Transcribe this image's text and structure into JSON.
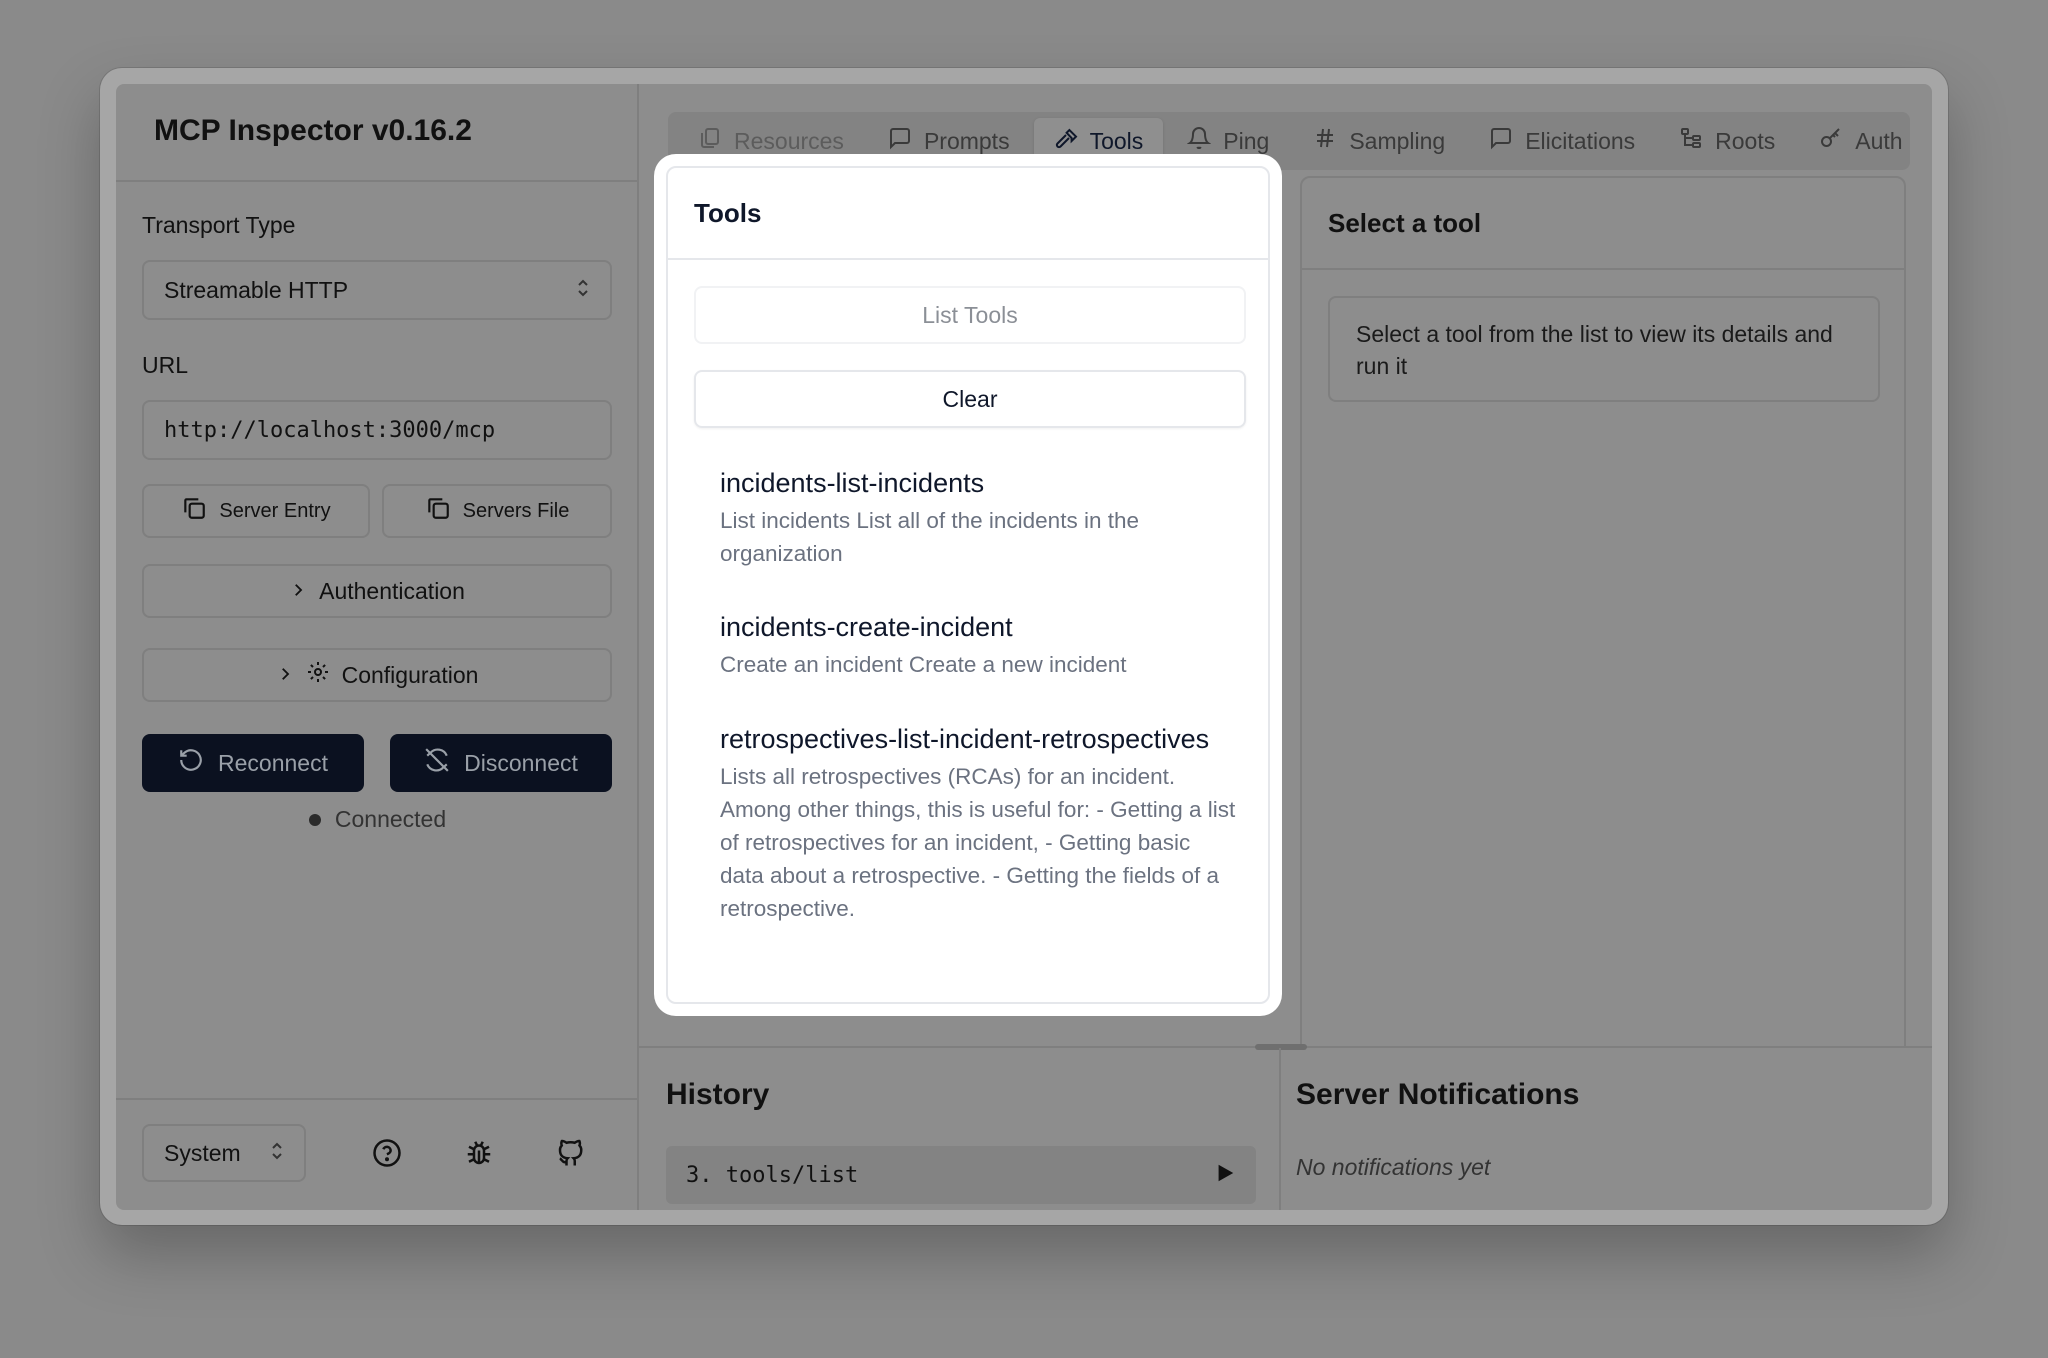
{
  "app": {
    "title": "MCP Inspector v0.16.2"
  },
  "sidebar": {
    "transport_label": "Transport Type",
    "transport_value": "Streamable HTTP",
    "url_label": "URL",
    "url_value": "http://localhost:3000/mcp",
    "server_entry_label": "Server Entry",
    "servers_file_label": "Servers File",
    "authentication_label": "Authentication",
    "configuration_label": "Configuration",
    "reconnect_label": "Reconnect",
    "disconnect_label": "Disconnect",
    "status_text": "Connected",
    "theme_value": "System"
  },
  "tabs": [
    {
      "label": "Resources",
      "icon": "file-icon",
      "state": "disabled"
    },
    {
      "label": "Prompts",
      "icon": "message-icon",
      "state": "normal"
    },
    {
      "label": "Tools",
      "icon": "hammer-icon",
      "state": "active"
    },
    {
      "label": "Ping",
      "icon": "bell-icon",
      "state": "normal"
    },
    {
      "label": "Sampling",
      "icon": "hash-icon",
      "state": "normal"
    },
    {
      "label": "Elicitations",
      "icon": "message-icon",
      "state": "normal"
    },
    {
      "label": "Roots",
      "icon": "tree-icon",
      "state": "normal"
    },
    {
      "label": "Auth",
      "icon": "key-icon",
      "state": "normal"
    }
  ],
  "tools_panel": {
    "title": "Tools",
    "list_button": "List Tools",
    "clear_button": "Clear",
    "tools": [
      {
        "name": "incidents-list-incidents",
        "description": "List incidents List all of the incidents in the organization"
      },
      {
        "name": "incidents-create-incident",
        "description": "Create an incident Create a new incident"
      },
      {
        "name": "retrospectives-list-incident-retrospectives",
        "description": "Lists all retrospectives (RCAs) for an incident. Among other things, this is useful for: - Getting a list of retrospectives for an incident, - Getting basic data about a retrospective. - Getting the fields of a retrospective."
      }
    ]
  },
  "detail_panel": {
    "title": "Select a tool",
    "hint": "Select a tool from the list to view its details and run it"
  },
  "history": {
    "title": "History",
    "items": [
      {
        "label": "3. tools/list"
      }
    ]
  },
  "notifications": {
    "title": "Server Notifications",
    "empty_text": "No notifications yet"
  }
}
